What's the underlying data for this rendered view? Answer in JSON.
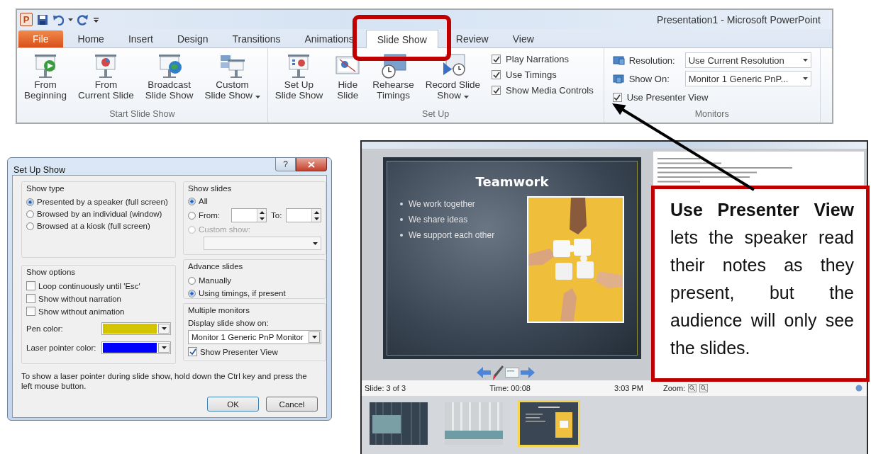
{
  "ribbon": {
    "app_icon_letter": "P",
    "title": "Presentation1  -  Microsoft PowerPoint",
    "tabs": [
      {
        "label": "File",
        "kind": "file",
        "selected": false
      },
      {
        "label": "Home",
        "kind": "tab",
        "selected": false
      },
      {
        "label": "Insert",
        "kind": "tab",
        "selected": false
      },
      {
        "label": "Design",
        "kind": "tab",
        "selected": false
      },
      {
        "label": "Transitions",
        "kind": "tab",
        "selected": false
      },
      {
        "label": "Animations",
        "kind": "tab",
        "selected": false
      },
      {
        "label": "Slide Show",
        "kind": "tab",
        "selected": true
      },
      {
        "label": "Review",
        "kind": "tab",
        "selected": false
      },
      {
        "label": "View",
        "kind": "tab",
        "selected": false
      }
    ],
    "groups": [
      {
        "label": "Start Slide Show",
        "buttons": [
          {
            "lines": [
              "From",
              "Beginning"
            ],
            "dropdown": false
          },
          {
            "lines": [
              "From",
              "Current Slide"
            ],
            "dropdown": false
          },
          {
            "lines": [
              "Broadcast",
              "Slide Show"
            ],
            "dropdown": false
          },
          {
            "lines": [
              "Custom",
              "Slide Show"
            ],
            "dropdown": true
          }
        ]
      },
      {
        "label": "Set Up",
        "buttons": [
          {
            "lines": [
              "Set Up",
              "Slide Show"
            ],
            "dropdown": false
          },
          {
            "lines": [
              "Hide",
              "Slide"
            ],
            "dropdown": false
          },
          {
            "lines": [
              "Rehearse",
              "Timings"
            ],
            "dropdown": false
          },
          {
            "lines": [
              "Record Slide",
              "Show"
            ],
            "dropdown": true
          }
        ],
        "checks": [
          {
            "label": "Play Narrations",
            "checked": true
          },
          {
            "label": "Use Timings",
            "checked": true
          },
          {
            "label": "Show Media Controls",
            "checked": true
          }
        ]
      },
      {
        "label": "Monitors",
        "fields": [
          {
            "label": "Resolution:",
            "value": "Use Current Resolution"
          },
          {
            "label": "Show On:",
            "value": "Monitor 1 Generic PnP..."
          }
        ],
        "checks": [
          {
            "label": "Use Presenter View",
            "checked": true
          }
        ]
      }
    ]
  },
  "dialog": {
    "title": "Set Up Show",
    "help": "?",
    "show_type": {
      "label": "Show type",
      "options": [
        {
          "label": "Presented by a speaker (full screen)",
          "selected": true
        },
        {
          "label": "Browsed by an individual (window)",
          "selected": false
        },
        {
          "label": "Browsed at a kiosk (full screen)",
          "selected": false
        }
      ]
    },
    "show_options": {
      "label": "Show options",
      "checks": [
        {
          "label": "Loop continuously until 'Esc'",
          "checked": false
        },
        {
          "label": "Show without narration",
          "checked": false
        },
        {
          "label": "Show without animation",
          "checked": false
        }
      ],
      "colors": [
        {
          "label": "Pen color:",
          "color": "#d4c400"
        },
        {
          "label": "Laser pointer color:",
          "color": "#0000ff"
        }
      ]
    },
    "show_slides": {
      "label": "Show slides",
      "options": [
        {
          "label": "All",
          "kind": "plain",
          "selected": true,
          "disabled": false
        },
        {
          "label": "From:",
          "kind": "range",
          "to_label": "To:",
          "selected": false,
          "disabled": false
        },
        {
          "label": "Custom show:",
          "kind": "custom",
          "selected": false,
          "disabled": true
        }
      ]
    },
    "advance_slides": {
      "label": "Advance slides",
      "options": [
        {
          "label": "Manually",
          "selected": false
        },
        {
          "label": "Using timings, if present",
          "selected": true
        }
      ]
    },
    "multiple_monitors": {
      "label": "Multiple monitors",
      "field_label": "Display slide show on:",
      "value": "Monitor 1 Generic PnP Monitor",
      "checks": [
        {
          "label": "Show Presenter View",
          "checked": true
        }
      ]
    },
    "hint": "To show a laser pointer during slide show, hold down the Ctrl key and press the left mouse button.",
    "buttons": [
      {
        "label": "OK",
        "default": true
      },
      {
        "label": "Cancel",
        "default": false
      }
    ]
  },
  "presenter": {
    "slide": {
      "title": "Teamwork",
      "bullets": [
        "We work together",
        "We share ideas",
        "We support each other"
      ]
    },
    "status": {
      "slide": "Slide: 3 of 3",
      "time": "Time: 00:08",
      "clock": "3:03 PM",
      "zoom": "Zoom:"
    },
    "thumbnails": [
      {
        "kind": "dark",
        "selected": false
      },
      {
        "kind": "light",
        "selected": false
      },
      {
        "kind": "teamwork",
        "selected": true
      }
    ]
  },
  "callout": {
    "text": "**Use Presenter View** lets the speaker read their notes as they present, but the audience will only see the slides."
  }
}
